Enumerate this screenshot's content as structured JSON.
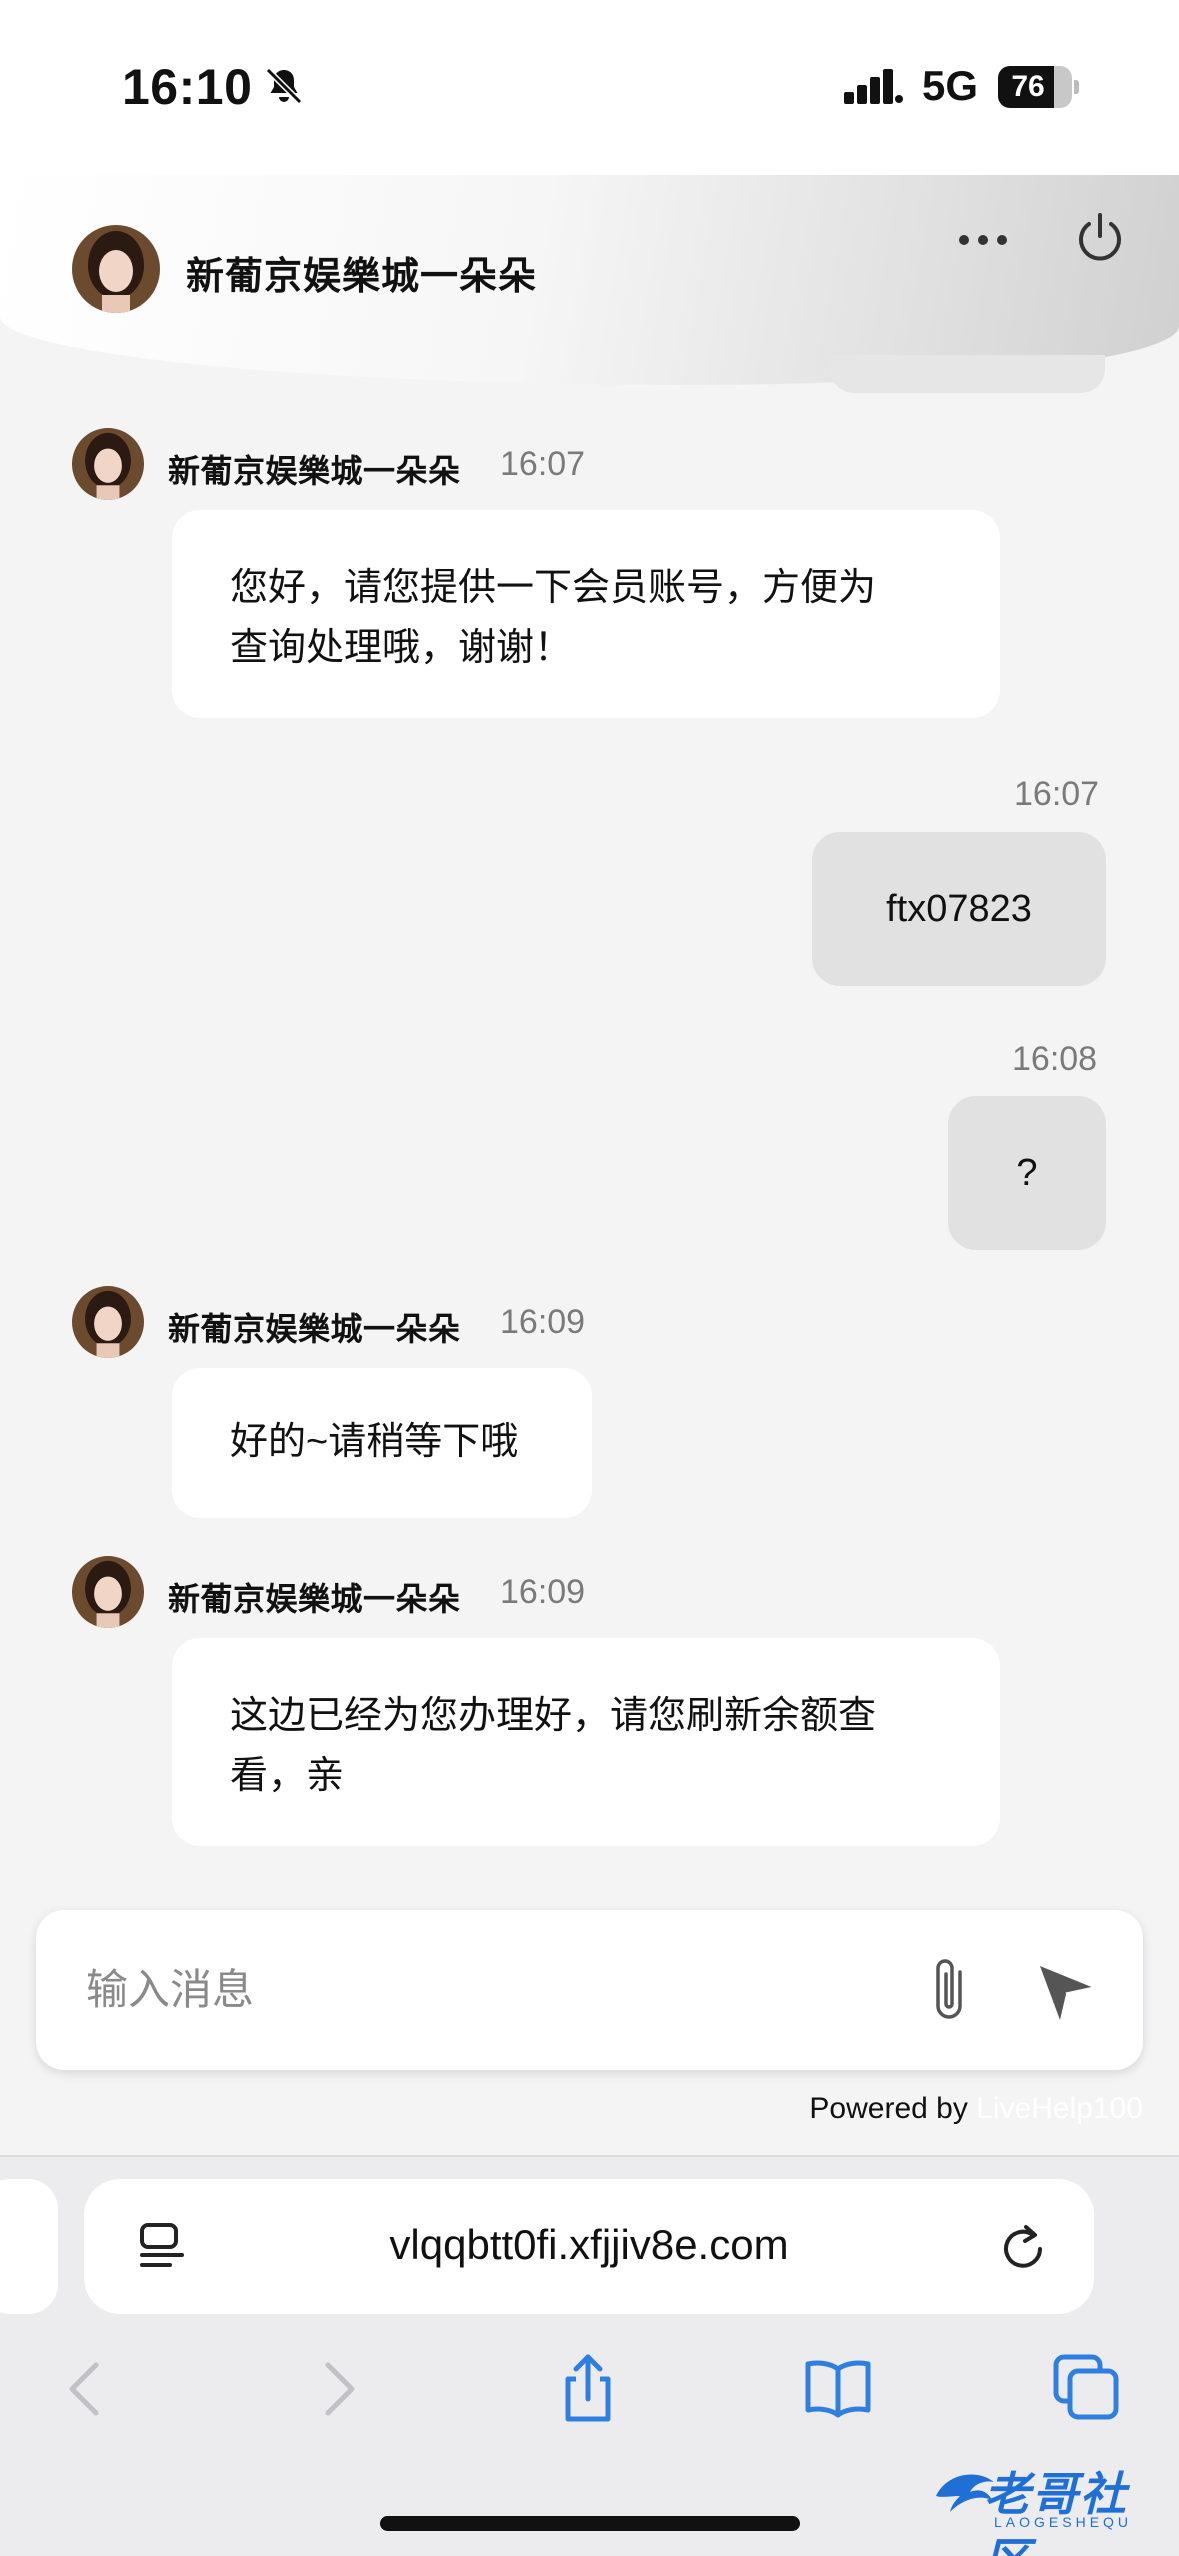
{
  "status_bar": {
    "time": "16:10",
    "network": "5G",
    "battery": "76",
    "battery_level": 0.76
  },
  "header": {
    "title": "新葡京娱樂城一朵朵",
    "icons": [
      "more-icon",
      "power-icon"
    ]
  },
  "messages": [
    {
      "from": "agent",
      "sender": "新葡京娱樂城一朵朵",
      "time": "16:07",
      "lines": [
        "您好，请您提供一下会员账号，方便为",
        "查询处理哦，谢谢！"
      ]
    },
    {
      "from": "user",
      "time": "16:07",
      "text": "ftx07823"
    },
    {
      "from": "user",
      "time": "16:08",
      "text": "?"
    },
    {
      "from": "agent",
      "sender": "新葡京娱樂城一朵朵",
      "time": "16:09",
      "lines": [
        "好的~请稍等下哦"
      ]
    },
    {
      "from": "agent",
      "sender": "新葡京娱樂城一朵朵",
      "time": "16:09",
      "lines": [
        "这边已经为您办理好，请您刷新余额查",
        "看，亲"
      ]
    }
  ],
  "composer": {
    "placeholder": "输入消息",
    "icons": [
      "paperclip-icon",
      "send-icon"
    ]
  },
  "footer": {
    "powered_by": "Powered by",
    "brand": "LiveHelp100"
  },
  "browser": {
    "url": "vlqqbtt0fi.xfjjiv8e.com",
    "accent": "#2f7fe0"
  },
  "watermark": {
    "text": "老哥社区",
    "sub": "LAOGESHEQU"
  }
}
